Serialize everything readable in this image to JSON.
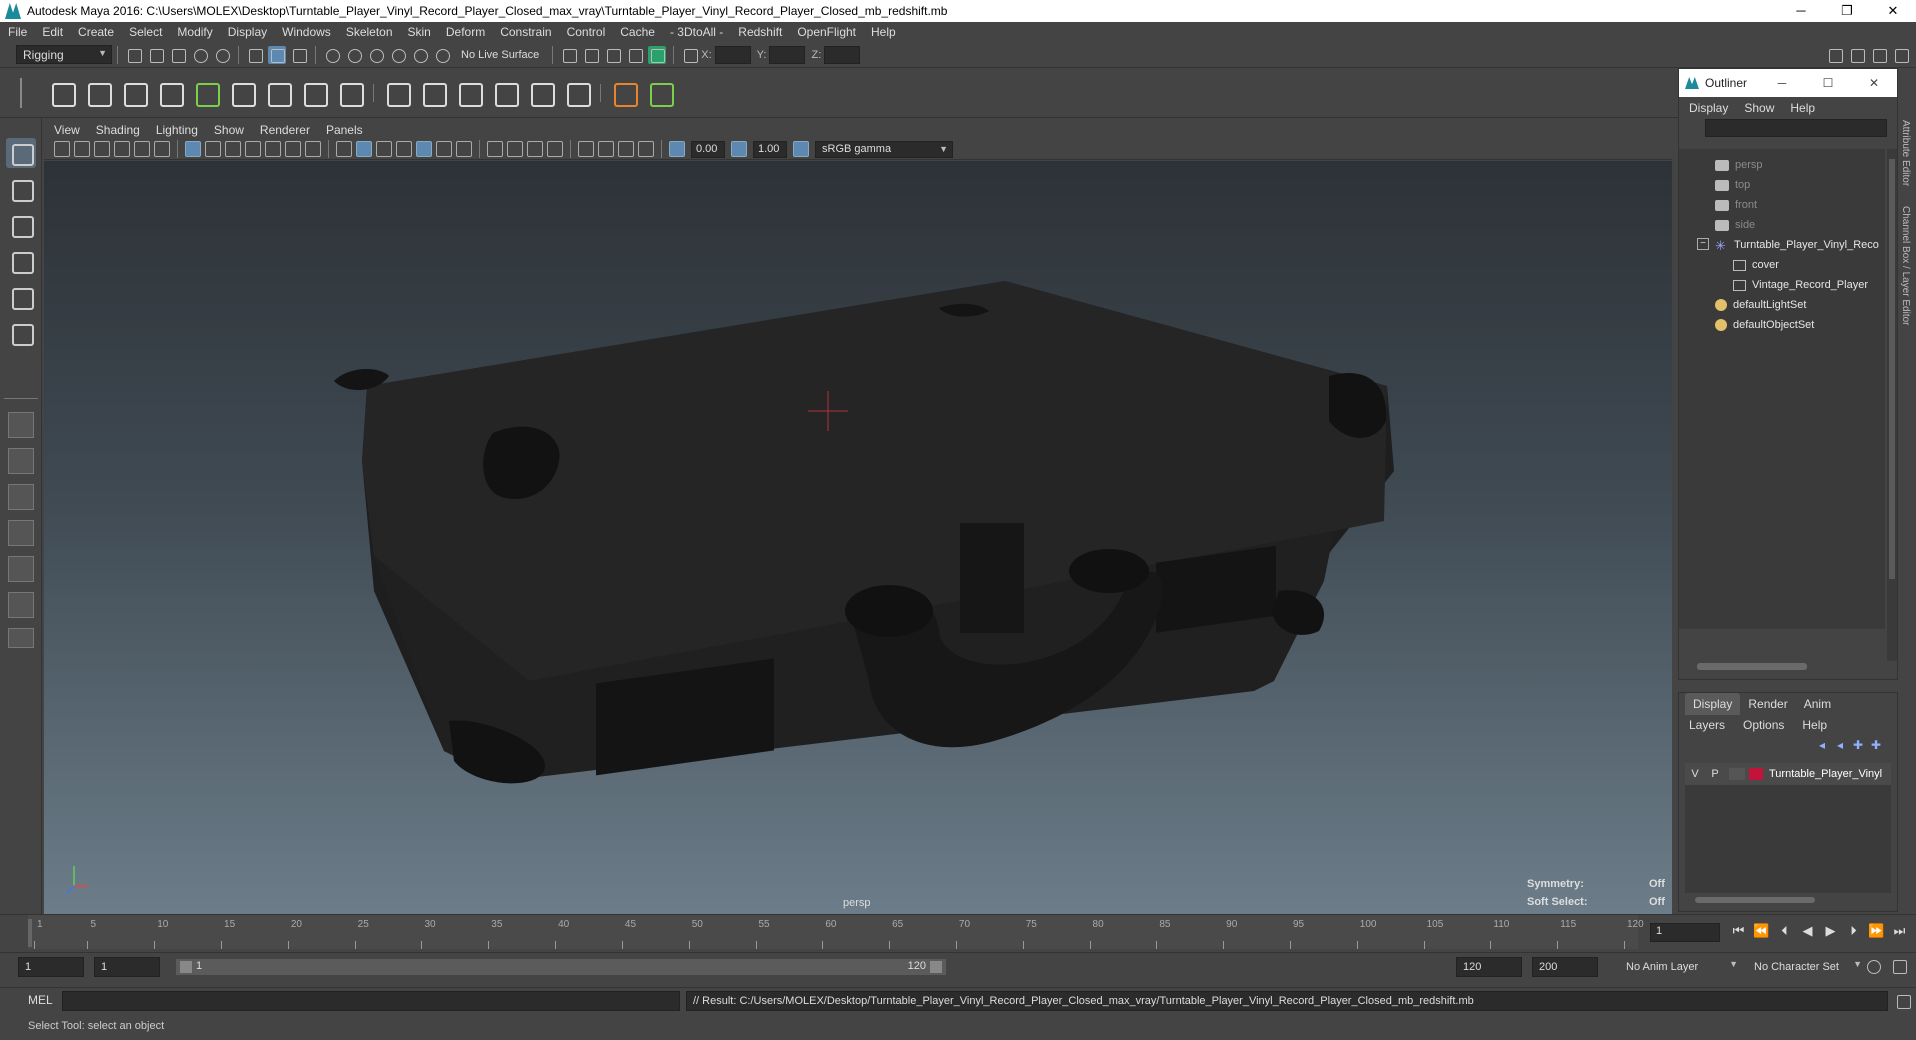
{
  "window": {
    "title": "Autodesk Maya 2016: C:\\Users\\MOLEX\\Desktop\\Turntable_Player_Vinyl_Record_Player_Closed_max_vray\\Turntable_Player_Vinyl_Record_Player_Closed_mb_redshift.mb",
    "minimize": "─",
    "restore": "❐",
    "close": "✕"
  },
  "menus": [
    "File",
    "Edit",
    "Create",
    "Select",
    "Modify",
    "Display",
    "Windows",
    "Skeleton",
    "Skin",
    "Deform",
    "Constrain",
    "Control",
    "Cache",
    "- 3DtoAll -",
    "Redshift",
    "OpenFlight",
    "Help"
  ],
  "status": {
    "menuset": "Rigging",
    "live_surface": "No Live Surface",
    "x_label": "X:",
    "y_label": "Y:",
    "z_label": "Z:"
  },
  "panel": {
    "menus": [
      "View",
      "Shading",
      "Lighting",
      "Show",
      "Renderer",
      "Panels"
    ],
    "exposure": "0.00",
    "gamma": "1.00",
    "colorspace": "sRGB gamma"
  },
  "viewport": {
    "camera": "persp",
    "symmetry_label": "Symmetry:",
    "symmetry_value": "Off",
    "soft_select_label": "Soft Select:",
    "soft_select_value": "Off"
  },
  "timeline": {
    "ticks": [
      "1",
      "5",
      "10",
      "15",
      "20",
      "25",
      "30",
      "35",
      "40",
      "45",
      "50",
      "55",
      "60",
      "65",
      "70",
      "75",
      "80",
      "85",
      "90",
      "95",
      "100",
      "105",
      "110",
      "115",
      "120"
    ],
    "current_frame": "1",
    "play_buttons": [
      "⏮",
      "⏪",
      "⏴",
      "◀",
      "▶",
      "⏵",
      "⏩",
      "⏭"
    ]
  },
  "range": {
    "start": "1",
    "playback_start": "1",
    "slider_left": "1",
    "slider_right": "120",
    "playback_end": "120",
    "end": "200",
    "anim_layer": "No Anim Layer",
    "character_set": "No Character Set"
  },
  "command": {
    "lang": "MEL",
    "result": "// Result: C:/Users/MOLEX/Desktop/Turntable_Player_Vinyl_Record_Player_Closed_max_vray/Turntable_Player_Vinyl_Record_Player_Closed_mb_redshift.mb"
  },
  "help_line": "Select Tool: select an object",
  "outliner": {
    "title": "Outliner",
    "menus": [
      "Display",
      "Show",
      "Help"
    ],
    "items": [
      {
        "label": "persp",
        "kind": "camera",
        "indent": 0,
        "dim": true
      },
      {
        "label": "top",
        "kind": "camera",
        "indent": 0,
        "dim": true
      },
      {
        "label": "front",
        "kind": "camera",
        "indent": 0,
        "dim": true
      },
      {
        "label": "side",
        "kind": "camera",
        "indent": 0,
        "dim": true
      },
      {
        "label": "Turntable_Player_Vinyl_Reco",
        "kind": "group",
        "indent": 0,
        "dim": false,
        "expander": "−"
      },
      {
        "label": "cover",
        "kind": "mesh",
        "indent": 1,
        "dim": false
      },
      {
        "label": "Vintage_Record_Player",
        "kind": "mesh",
        "indent": 1,
        "dim": false
      },
      {
        "label": "defaultLightSet",
        "kind": "set",
        "indent": 0,
        "dim": false
      },
      {
        "label": "defaultObjectSet",
        "kind": "set",
        "indent": 0,
        "dim": false
      }
    ]
  },
  "side_tabs": [
    "Attribute Editor",
    "Channel Box / Layer Editor"
  ],
  "layer_editor": {
    "tabs": [
      "Display",
      "Render",
      "Anim"
    ],
    "menus": [
      "Layers",
      "Options",
      "Help"
    ],
    "layer": {
      "v": "V",
      "p": "P",
      "name": "Turntable_Player_Vinyl",
      "color": "#c2143b"
    }
  },
  "colors": {
    "accent": "#5d88b1",
    "layer": "#c2143b"
  }
}
